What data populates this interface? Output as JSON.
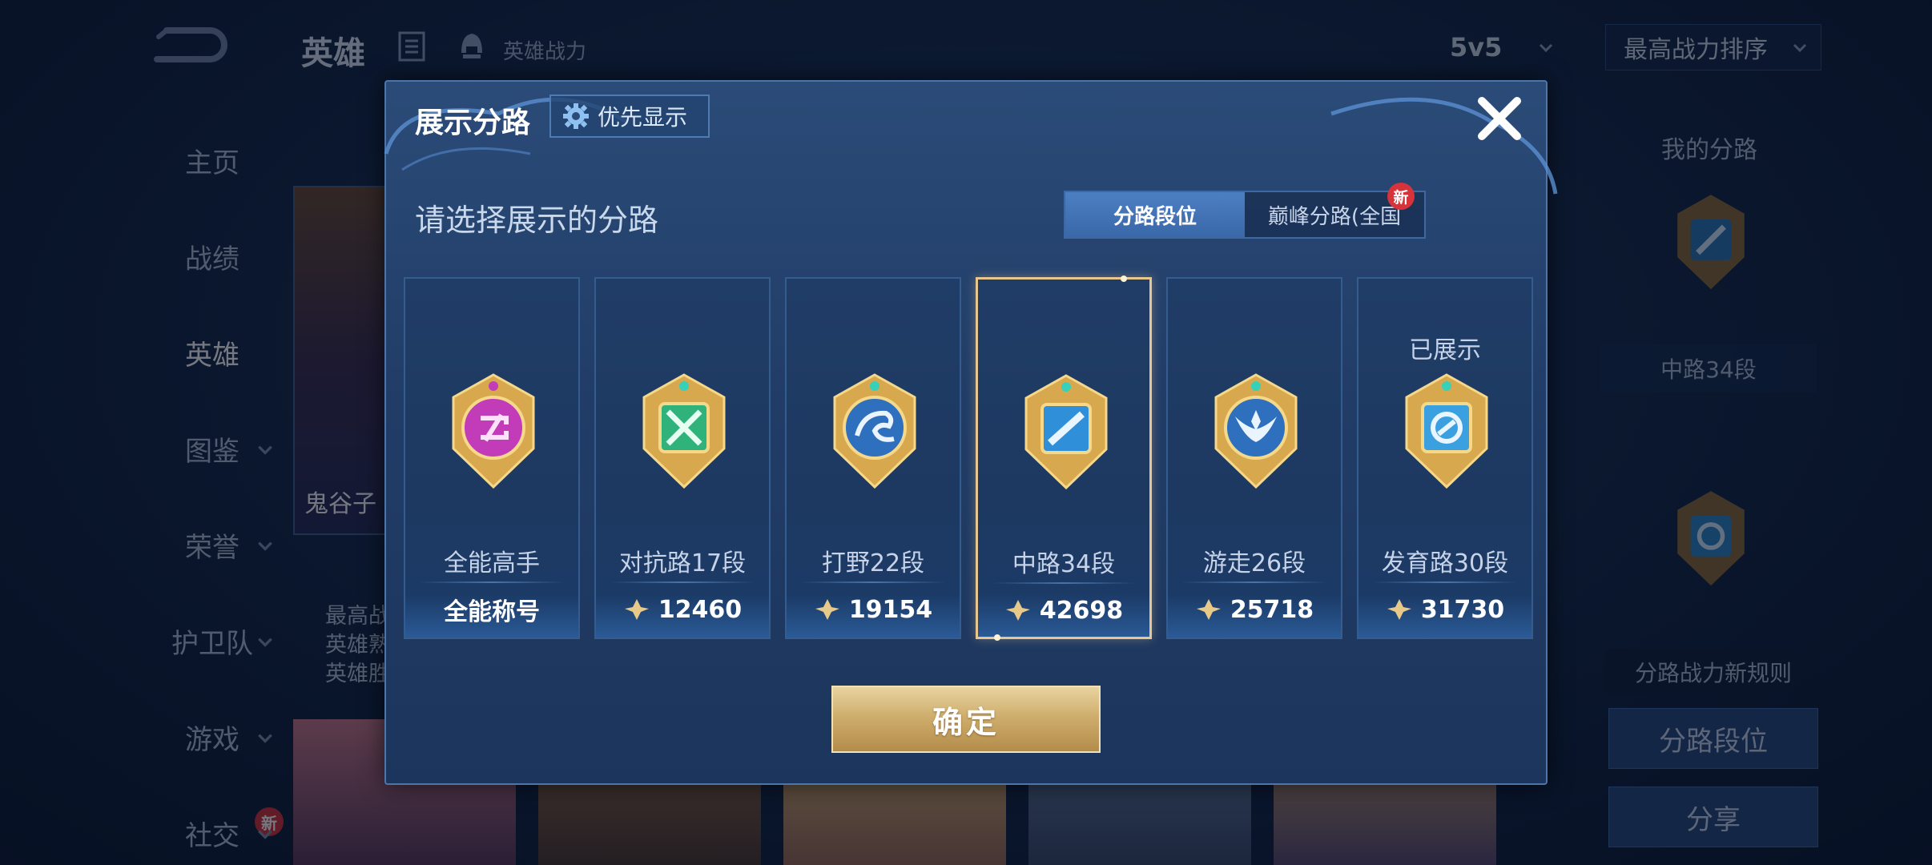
{
  "header": {
    "title": "英雄",
    "power_label": "英雄战力",
    "mode": "5v5",
    "sort": "最高战力排序"
  },
  "sidebar": {
    "items": [
      {
        "label": "主页"
      },
      {
        "label": "战绩"
      },
      {
        "label": "英雄"
      },
      {
        "label": "图鉴"
      },
      {
        "label": "荣誉"
      },
      {
        "label": "护卫队"
      },
      {
        "label": "游戏"
      },
      {
        "label": "社交",
        "badge": "新"
      }
    ]
  },
  "hero": {
    "name": "鬼谷子",
    "stats": [
      "最高战",
      "英雄熟",
      "英雄胜"
    ]
  },
  "right_panel": {
    "title": "我的分路",
    "lane_label": "中路34段",
    "rule_button": "分路战力新规则",
    "lane_button": "分路段位",
    "share_button": "分享"
  },
  "modal": {
    "title": "展示分路",
    "priority_button": "优先显示",
    "subtitle": "请选择展示的分路",
    "tabs": [
      {
        "label": "分路段位",
        "active": true
      },
      {
        "label": "巅峰分路(全国",
        "badge": "新"
      }
    ],
    "cards": [
      {
        "lane": "全能高手",
        "value": "全能称号",
        "color": "#c23bb8",
        "icon": "allround-emblem"
      },
      {
        "lane": "对抗路17段",
        "value": "12460",
        "color": "#2fb37a",
        "icon": "clash-lane-emblem"
      },
      {
        "lane": "打野22段",
        "value": "19154",
        "color": "#3a86d6",
        "icon": "jungle-emblem"
      },
      {
        "lane": "中路34段",
        "value": "42698",
        "color": "#2f8fd8",
        "icon": "mid-lane-emblem",
        "selected": true
      },
      {
        "lane": "游走26段",
        "value": "25718",
        "color": "#3a86d6",
        "icon": "roam-emblem"
      },
      {
        "lane": "发育路30段",
        "value": "31730",
        "color": "#3aa0e0",
        "icon": "farm-lane-emblem",
        "shown_label": "已展示"
      }
    ],
    "confirm_button": "确定"
  }
}
